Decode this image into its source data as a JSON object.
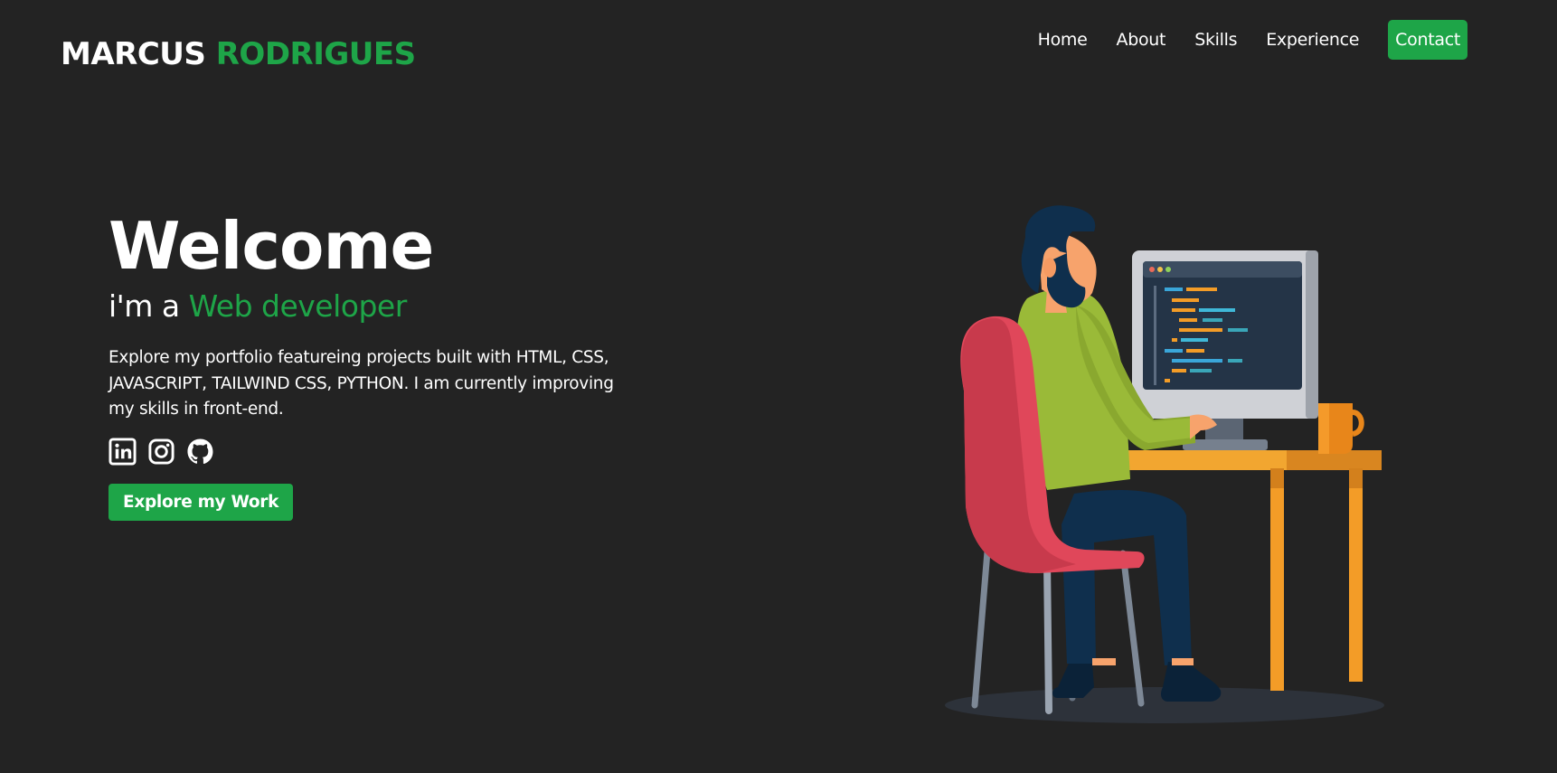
{
  "header": {
    "logo_first": "MARCUS",
    "logo_last": "RODRIGUES",
    "nav": [
      "Home",
      "About",
      "Skills",
      "Experience",
      "Contact"
    ]
  },
  "hero": {
    "title": "Welcome",
    "subtitle_prefix": "i'm a ",
    "subtitle_accent": "Web developer",
    "description": "Explore my portfolio featureing projects built with HTML, CSS, JAVASCRIPT, TAILWIND CSS, PYTHON. I am currently improving my skills in front-end.",
    "socials": [
      "linkedin-icon",
      "instagram-icon",
      "github-icon"
    ],
    "cta_label": "Explore my Work"
  },
  "colors": {
    "background": "#232323",
    "accent": "#1ea548",
    "text": "#ffffff"
  }
}
